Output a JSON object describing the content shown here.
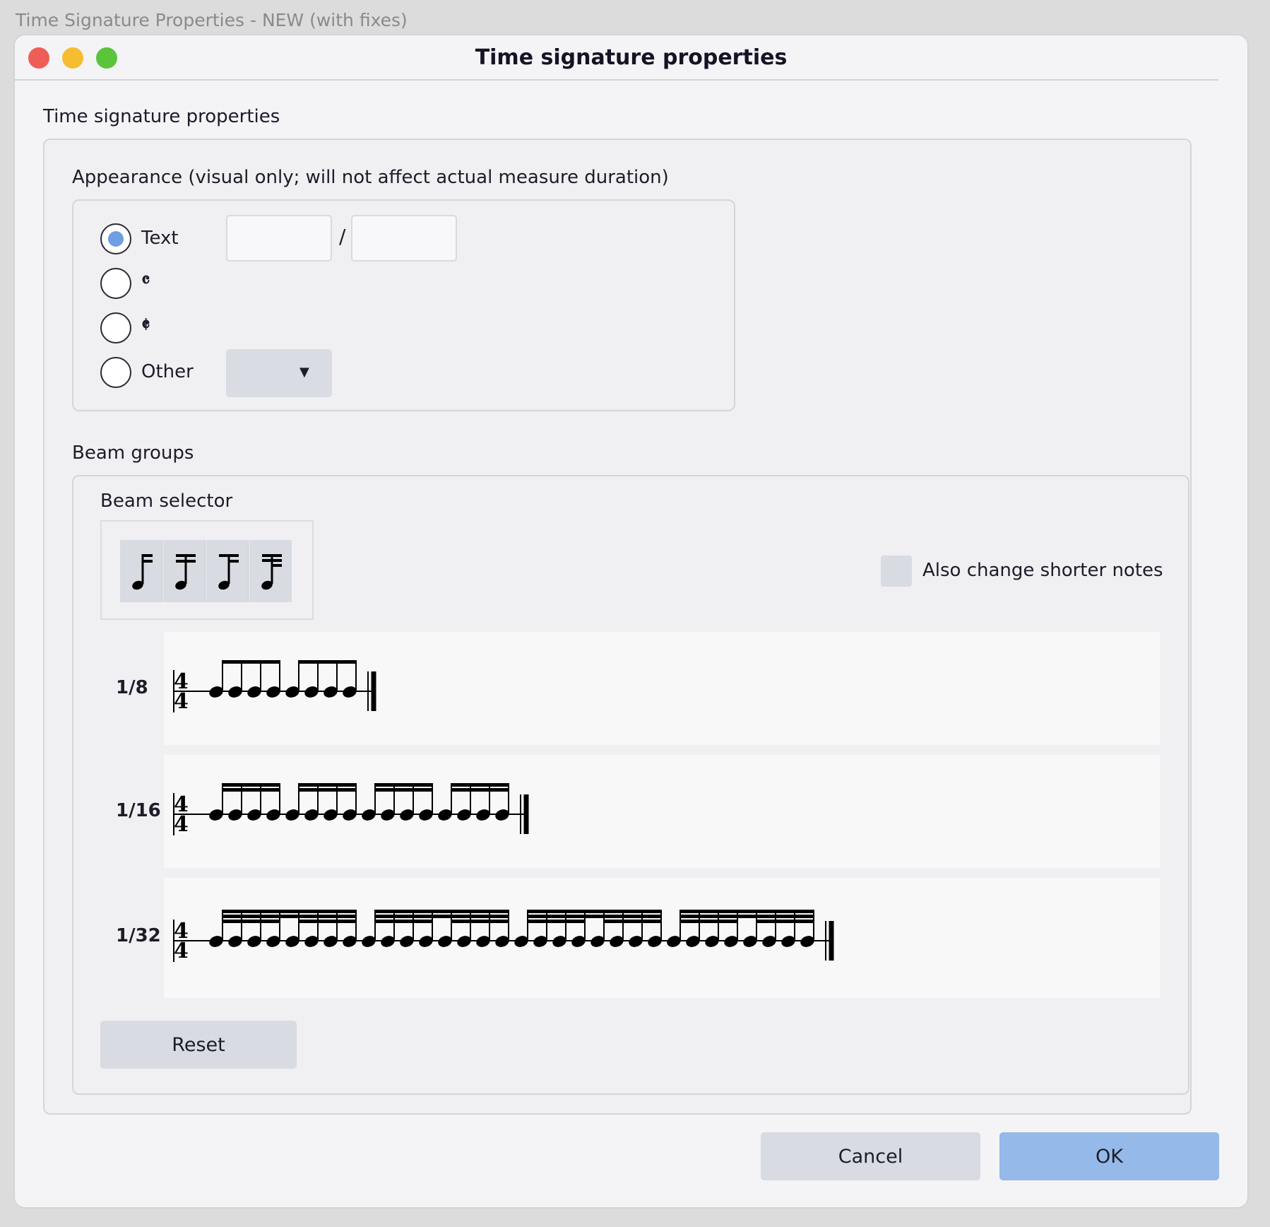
{
  "outer_title": "Time Signature Properties - NEW (with fixes)",
  "window": {
    "title": "Time signature properties"
  },
  "main": {
    "section_title": "Time signature properties",
    "appearance": {
      "label": "Appearance (visual only; will not affect actual measure duration)",
      "options": [
        {
          "label": "Text",
          "checked": true
        },
        {
          "label": "𝄴",
          "checked": false
        },
        {
          "label": "𝄵",
          "checked": false
        },
        {
          "label": "Other",
          "checked": false
        }
      ],
      "numerator_value": "",
      "denominator_value": "",
      "separator": "/",
      "other_selected": ""
    },
    "beam_groups": {
      "label": "Beam groups",
      "selector_label": "Beam selector",
      "selector_buttons": [
        "beam-break-icon",
        "beam-continue-icon",
        "beam-32nd-break-icon",
        "beam-64th-break-icon"
      ],
      "also_change_shorter_label": "Also change shorter notes",
      "also_change_shorter_checked": false,
      "rows": [
        {
          "label": "1/8",
          "notes": 8,
          "levels": 1,
          "group_size": 4
        },
        {
          "label": "1/16",
          "notes": 16,
          "levels": 2,
          "group_size": 4
        },
        {
          "label": "1/32",
          "notes": 32,
          "levels": 3,
          "group_size": 4
        }
      ],
      "reset_label": "Reset"
    }
  },
  "footer": {
    "cancel_label": "Cancel",
    "ok_label": "OK"
  },
  "colors": {
    "accent": "#95b9e9",
    "radio_selected": "#6f9fe3"
  }
}
